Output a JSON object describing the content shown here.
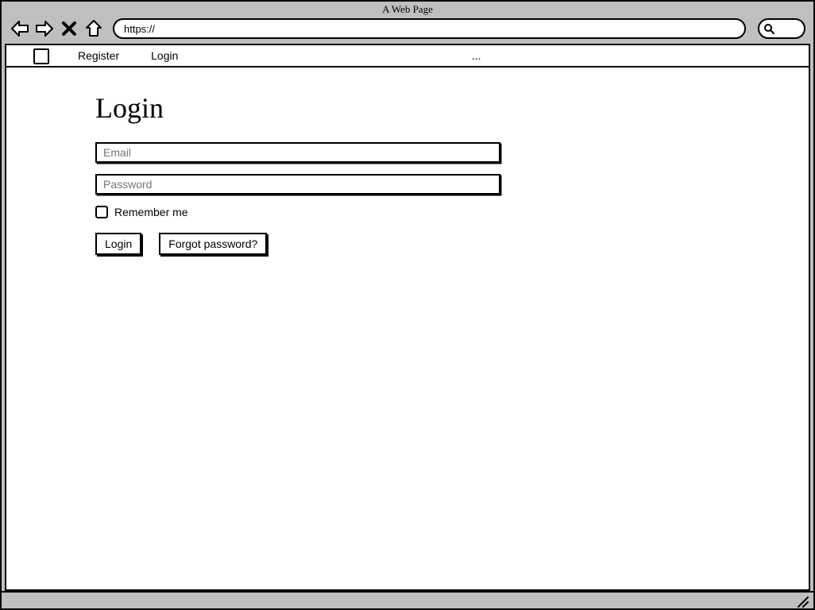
{
  "browser": {
    "title": "A Web Page",
    "url_prefix": "https://"
  },
  "menu": {
    "items": [
      {
        "label": "Register"
      },
      {
        "label": "Login"
      }
    ],
    "overflow": "..."
  },
  "page": {
    "heading": "Login",
    "email_placeholder": "Email",
    "password_placeholder": "Password",
    "remember_label": "Remember me",
    "login_button": "Login",
    "forgot_button": "Forgot password?"
  }
}
